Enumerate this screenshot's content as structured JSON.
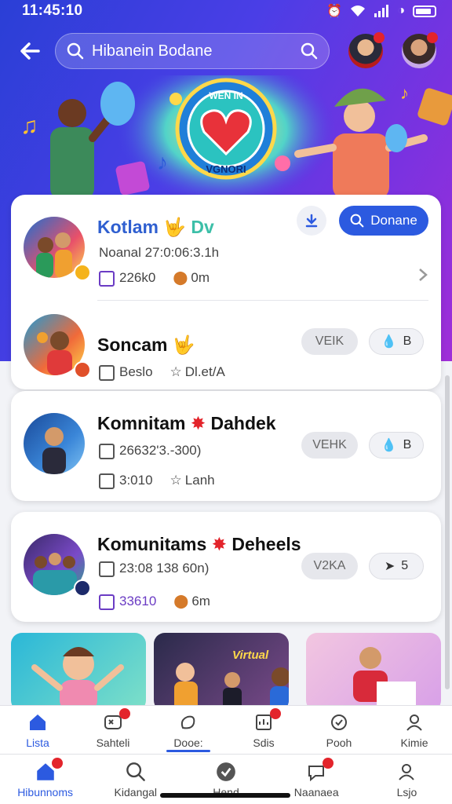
{
  "status": {
    "time": "11:45:10"
  },
  "header": {
    "search_text": "Hibanein Bodane"
  },
  "banner": {
    "sign_top": "WEN IN",
    "sign_bottom": "VGNORI"
  },
  "card1": {
    "rows": [
      {
        "name": "Kotlam",
        "name_suffix": "🤟 Dv",
        "subtitle": "Noanal 27:0:06:3.1h",
        "meta1": "226k0",
        "meta2": "0m",
        "action_label": "Donane"
      },
      {
        "name": "Soncam",
        "name_suffix": "🤟",
        "meta1": "Beslo",
        "meta2": "Dl.et/A",
        "pill1": "VEIK",
        "pill2": "B"
      }
    ]
  },
  "card2": {
    "name": "Komnitam",
    "name_suffix": "Dahdek",
    "line1": "26632'3.-300)",
    "meta1": "3:010",
    "meta2": "Lanh",
    "pill1": "VEHK",
    "pill2": "B"
  },
  "card3": {
    "name": "Komunitams",
    "name_suffix": "Deheels",
    "line1": "23:08 138  60n)",
    "meta1": "33610",
    "meta2": "6m",
    "pill1": "V2KA",
    "pill2": "5"
  },
  "thumbs": {
    "thumb2_text": "Virtual"
  },
  "tabbar_top": [
    {
      "label": "Lista"
    },
    {
      "label": "Sahteli"
    },
    {
      "label": "Dooe:"
    },
    {
      "label": "Sdis"
    },
    {
      "label": "Pooh"
    },
    {
      "label": "Kimie"
    }
  ],
  "tabbar_bottom": [
    {
      "label": "Hibunnoms"
    },
    {
      "label": "Kidangal"
    },
    {
      "label": "Hend"
    },
    {
      "label": "Naanaea"
    },
    {
      "label": "Lsjo"
    }
  ],
  "colors": {
    "primary": "#2c5ae0",
    "badge": "#e3242b",
    "gradient_start": "#2a3fd6",
    "gradient_end": "#a02ed8"
  }
}
